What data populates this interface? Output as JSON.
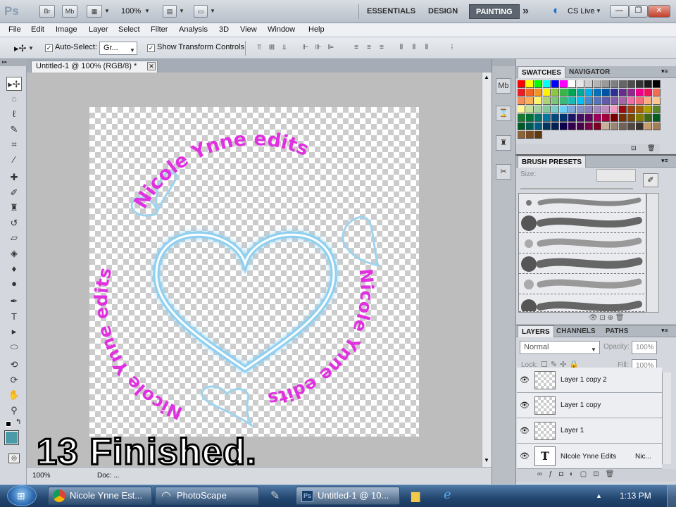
{
  "appbar": {
    "logo": "Ps",
    "br_label": "Br",
    "mb_label": "Mb",
    "zoom": "100%",
    "workspaces": [
      "ESSENTIALS",
      "DESIGN",
      "PAINTING"
    ],
    "active_workspace": "PAINTING",
    "more": "»",
    "cs_live": "CS Live",
    "win_min": "—",
    "win_max": "❐",
    "win_close": "✕"
  },
  "menubar": {
    "items": [
      "File",
      "Edit",
      "Image",
      "Layer",
      "Select",
      "Filter",
      "Analysis",
      "3D",
      "View",
      "Window",
      "Help"
    ]
  },
  "options": {
    "auto_select_label": "Auto-Select:",
    "auto_select_checked": true,
    "auto_select_value": "Gr...",
    "show_transform_label": "Show Transform Controls",
    "show_transform_checked": true
  },
  "document": {
    "tab_title": "Untitled-1 @ 100% (RGB/8) *",
    "zoom_status": "100%",
    "doc_status": "Doc: ...",
    "canvas_text_top": "Nicole Ynne edits",
    "canvas_text_right": "Nicole Ynne edits",
    "canvas_text_left": "Nicole Ynne edits",
    "overlay_caption": "13 Finished."
  },
  "panels": {
    "swatches_tab": "SWATCHES",
    "navigator_tab": "NAVIGATOR",
    "brush_presets_tab": "BRUSH PRESETS",
    "brush_size_label": "Size:",
    "layers_tab": "LAYERS",
    "channels_tab": "CHANNELS",
    "paths_tab": "PATHS",
    "blend_mode": "Normal",
    "opacity_label": "Opacity:",
    "opacity_value": "100%",
    "lock_label": "Lock:",
    "fill_label": "Fill:",
    "fill_value": "100%",
    "layers": [
      {
        "name": "Layer 1 copy 2",
        "type": "pixel"
      },
      {
        "name": "Layer 1 copy",
        "type": "pixel"
      },
      {
        "name": "Layer 1",
        "type": "pixel"
      },
      {
        "name": "NIcole Ynne Edits",
        "type": "text",
        "extra": "Nic..."
      }
    ]
  },
  "colors": {
    "canvas_text": "#e030e0",
    "heart_stroke": "#8fd0f0",
    "foreground": "#000000",
    "background_swatch": "#4a9aa8",
    "swatches": [
      "#ff0000",
      "#ffff00",
      "#00ff00",
      "#00ffff",
      "#0000ff",
      "#ff00ff",
      "#ffffff",
      "#e6e6e6",
      "#cccccc",
      "#b3b3b3",
      "#999999",
      "#808080",
      "#666666",
      "#4d4d4d",
      "#333333",
      "#1a1a1a",
      "#000000",
      "#ed1c24",
      "#f26522",
      "#f7941d",
      "#fff200",
      "#8dc63f",
      "#39b54a",
      "#00a651",
      "#00a99d",
      "#00aeef",
      "#0072bc",
      "#0054a6",
      "#2e3192",
      "#662d91",
      "#92278f",
      "#ec008c",
      "#ed145b",
      "#f26c4f",
      "#f68e56",
      "#fbaf5d",
      "#fff568",
      "#acd373",
      "#7cc576",
      "#3cb878",
      "#1abbb4",
      "#00bff3",
      "#448ccb",
      "#5674b9",
      "#605ca8",
      "#8560a8",
      "#a864a8",
      "#f06eaa",
      "#f26d7d",
      "#f9ad81",
      "#fdc68a",
      "#fff799",
      "#c4df9b",
      "#a3d39c",
      "#82ca9c",
      "#7accc8",
      "#6dcff6",
      "#7da7d9",
      "#8393ca",
      "#8781bd",
      "#a187be",
      "#bd8cbf",
      "#f49ac1",
      "#9e0b0f",
      "#a0410d",
      "#a36209",
      "#aba000",
      "#598527",
      "#1a7b30",
      "#007236",
      "#00746b",
      "#0076a3",
      "#004a80",
      "#003471",
      "#1b1464",
      "#440e62",
      "#630460",
      "#9e005d",
      "#9e0039",
      "#790000",
      "#7b2e00",
      "#7d4900",
      "#827b00",
      "#406618",
      "#005e20",
      "#005826",
      "#005952",
      "#005b7f",
      "#003663",
      "#002157",
      "#0d004c",
      "#32004b",
      "#4b0049",
      "#7b0046",
      "#7a0026",
      "#c7b299",
      "#998675",
      "#736357",
      "#534741",
      "#37302d",
      "#c69c6d",
      "#a67c52",
      "#8c6239",
      "#754c24",
      "#603913"
    ]
  },
  "taskbar": {
    "items": [
      "Nicole Ynne Est...",
      "PhotoScape",
      "Untitled-1 @ 10..."
    ],
    "clock": "1:13 PM"
  }
}
